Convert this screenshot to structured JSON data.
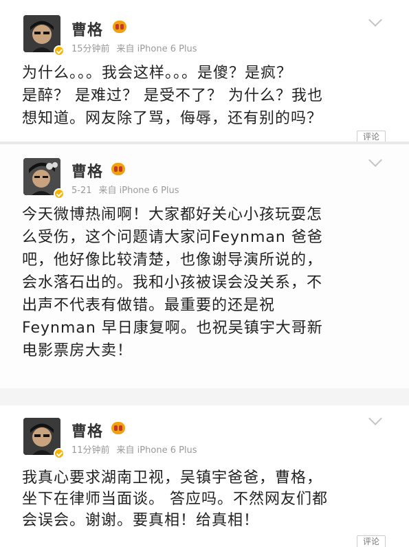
{
  "posts": [
    {
      "username": "曹格",
      "time": "15分钟前",
      "source": "来自 iPhone 6 Plus",
      "content_lines": [
        "为什么。。。我会这样。。。是傻？是疯？",
        "是醉？ 是难过？ 是受不了？ 为什么？我也",
        "想知道。网友除了骂，侮辱，还有别的吗？"
      ],
      "comment_label": "评论"
    },
    {
      "username": "曹格",
      "time": "5-21",
      "source": "来自 iPhone 6 Plus",
      "content_lines": [
        "今天微博热闹啊！大家都好关心小孩玩耍怎",
        "么受伤，这个问题请大家问Feynman 爸爸",
        "吧，他好像比较清楚，也像谢导演所说的，",
        "会水落石出的。我和小孩被误会没关系，不",
        "出声不代表有做错。最重要的还是祝",
        "Feynman 早日康复啊。也祝吴镇宇大哥新",
        "电影票房大卖！"
      ]
    },
    {
      "username": "曹格",
      "time": "11分钟前",
      "source": "来自 iPhone 6 Plus",
      "content_lines": [
        "我真心要求湖南卫视，吴镇宇爸爸，曹格，",
        "坐下在律师当面谈。 答应吗。不然网友们都",
        "会误会。谢谢。要真相！给真相！"
      ],
      "comment_label": "评论"
    }
  ]
}
